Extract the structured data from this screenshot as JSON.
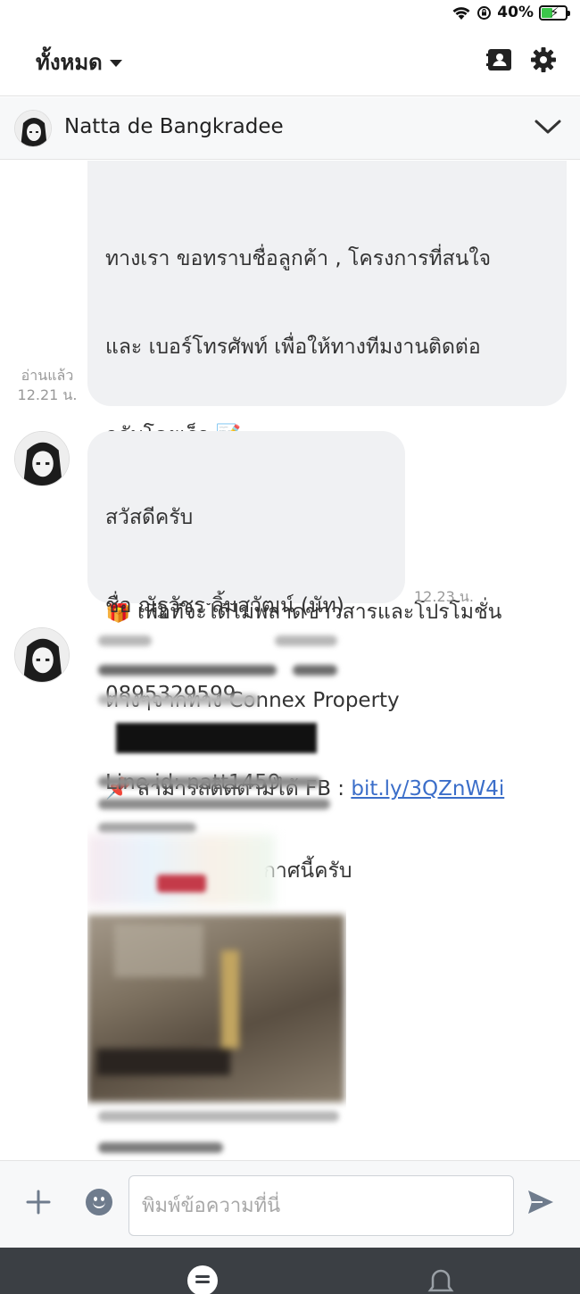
{
  "status_bar": {
    "battery": "40%"
  },
  "header": {
    "filter_label": "ทั้งหมด"
  },
  "chat": {
    "name": "Natta de Bangkradee"
  },
  "messages": [
    {
      "from": "me",
      "lines": [
        "ทางเรา ขอทราบชื่อลูกค้า , โครงการที่สนใจ",
        "และ เบอร์โทรศัพท์ เพื่อให้ทางทีมงานติดต่อ",
        "กลับโดยเร็ว 📝",
        "",
        "🎁 เพื่อที่จะได้ไม่พลาดข่าวสารและโปรโมชั่น",
        "ต่างๆจากทาง Connex Property"
      ],
      "last_line_prefix": "📌 สามารถติดตามได้ FB : ",
      "link": "bit.ly/3QZnW4i",
      "read_label": "อ่านแล้ว",
      "time": "12.21 น."
    },
    {
      "from": "contact",
      "lines": [
        "สวัสดีครับ",
        "ชื่อ ณัฐวัชร ลิ้มสุวัฒน์ (นัท)",
        "0895329599",
        "Line id: natt1459",
        "สนใจห้องตามประกาศนี้ครับ"
      ],
      "time": "12.23 น."
    }
  ],
  "input": {
    "placeholder": "พิมพ์ข้อความที่นี่"
  }
}
